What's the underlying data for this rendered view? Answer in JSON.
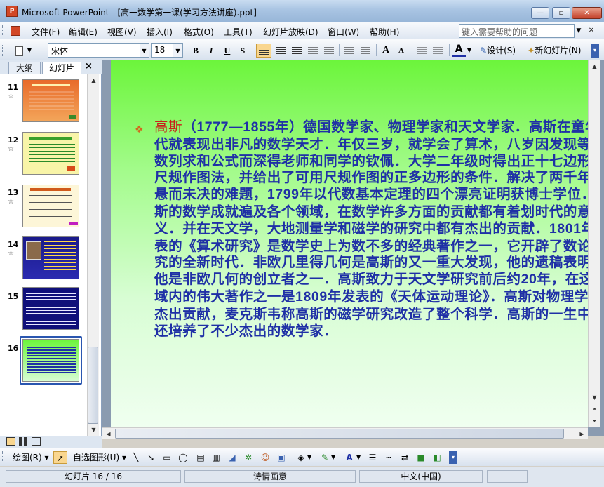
{
  "window": {
    "title": "Microsoft PowerPoint - [高一数学第一课(学习方法讲座).ppt]",
    "app_icon": "P"
  },
  "window_controls": {
    "minimize": "—",
    "restore": "▫",
    "close": "✕"
  },
  "menu": {
    "items": [
      "文件(F)",
      "编辑(E)",
      "视图(V)",
      "插入(I)",
      "格式(O)",
      "工具(T)",
      "幻灯片放映(D)",
      "窗口(W)",
      "帮助(H)"
    ],
    "help_placeholder": "键入需要帮助的问题"
  },
  "toolbar": {
    "font_name": "宋体",
    "font_size": "18",
    "bold": "B",
    "italic": "I",
    "underline": "U",
    "shadow": "S",
    "increase_font": "A",
    "decrease_font": "A",
    "design_label": "设计(S)",
    "new_slide_label": "新幻灯片(N)"
  },
  "left_pane": {
    "tabs": [
      "大纲",
      "幻灯片"
    ],
    "close": "×",
    "thumbnails": [
      {
        "number": "11",
        "star": "☆"
      },
      {
        "number": "12",
        "star": "☆"
      },
      {
        "number": "13",
        "star": "☆"
      },
      {
        "number": "14",
        "star": "☆"
      },
      {
        "number": "15",
        "star": ""
      },
      {
        "number": "16",
        "star": ""
      }
    ],
    "selected": "16"
  },
  "slide": {
    "bullet": "❖",
    "name": "高斯",
    "body_a": "（",
    "years": "1777—1855",
    "body_b": "年）德国数学家、物理学家和天文学家．高斯在童年时代就表现出非凡的数学天才．年仅三岁，就学会了算术，八岁因发现等差数列求和公式而深得老师和同学的钦佩．大学二年级时得出正十七边形的尺规作图法，并给出了可用尺规作图的正多边形的条件．解决了两千年来悬而未决的难题，",
    "year1799": "1799",
    "body_c": "年以代数基本定理的四个漂亮证明获博士学位．高斯的数学成就遍及各个领域，在数学许多方面的贡献都有着划时代的意义．并在天文学，大地测量学和磁学的研究中都有杰出的贡献．",
    "year1801": "1801",
    "body_d": "年发表的《算术研究》是数学史上为数不多的经典著作之一，它开辟了数论研究的全新时代．非欧几里得几何是高斯的又一重大发现，他的遗稿表明，他是非欧几何的创立者之一．高斯致力于天文学研究前后约",
    "years20": "20",
    "body_e": "年，在这领域内的伟大著作之一是",
    "year1809": "1809",
    "body_f": "年发表的《天体运动理论》．高斯对物理学也有杰出贡献，麦克斯韦称高斯的磁学研究改造了整个科学．高斯的一生中，还培养了不少杰出的数学家．"
  },
  "drawing_toolbar": {
    "draw_label": "绘图(R)",
    "autoshape_label": "自选图形(U)"
  },
  "status": {
    "slide_count": "幻灯片 16 / 16",
    "design": "诗情画意",
    "language": "中文(中国)"
  },
  "colors": {
    "slide_text": "#1f30a6",
    "slide_name": "#c8201a",
    "slide_bg_top": "#6cf53b",
    "accent_selected": "#2a56b0"
  }
}
